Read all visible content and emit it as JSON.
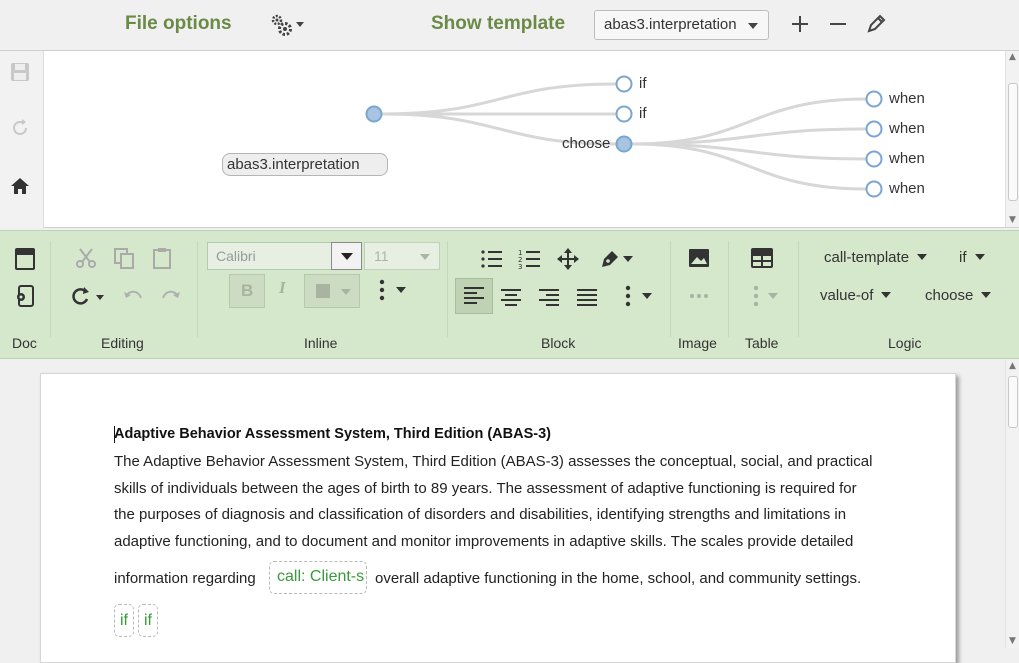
{
  "topbar": {
    "file_options": "File options",
    "show_template": "Show template",
    "template_select": "abas3.interpretation"
  },
  "tree": {
    "root": "abas3.interpretation",
    "level1": [
      "if",
      "if",
      "choose"
    ],
    "level2": [
      "when",
      "when",
      "when",
      "when"
    ]
  },
  "ribbon": {
    "font_name": "Calibri",
    "font_size": "11",
    "groups": [
      "Doc",
      "Editing",
      "Inline",
      "Block",
      "Image",
      "Table",
      "Logic"
    ],
    "logic": {
      "call_template": "call-template",
      "if": "if",
      "value_of": "value-of",
      "choose": "choose"
    }
  },
  "document": {
    "title": "Adaptive Behavior Assessment System, Third Edition (ABAS-3)",
    "lines": [
      "The Adaptive Behavior Assessment System, Third Edition (ABAS-3) assesses the conceptual, social, and practical",
      "skills of individuals between the ages of birth to 89 years. The assessment of adaptive functioning is required for",
      "the purposes of diagnosis and classification of disorders and disabilities, identifying strengths and limitations in",
      "adaptive functioning, and to document and monitor improvements in adaptive skills. The scales provide detailed"
    ],
    "line5_before": "information regarding",
    "chip_call": "call: Client-s",
    "line5_after": "overall adaptive functioning in the home, school, and community settings.",
    "chip_if_1": "if",
    "chip_if_2": "if"
  },
  "colors": {
    "accent_green": "#6a8a45",
    "ribbon_bg": "#d5e8cc",
    "chip_text": "#3a9a3a",
    "node_ring": "#7aa6cf"
  },
  "icons": [
    "gear-icon",
    "plus-icon",
    "minus-icon",
    "pencil-icon",
    "save-icon",
    "refresh-icon",
    "home-icon"
  ]
}
